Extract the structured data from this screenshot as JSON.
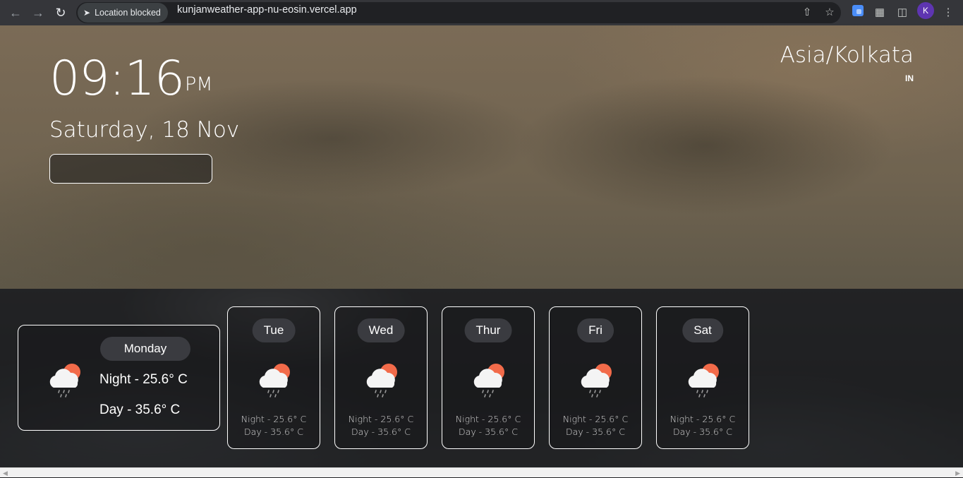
{
  "browser": {
    "location_chip": "Location blocked",
    "url": "kunjanweather-app-nu-eosin.vercel.app",
    "avatar_letter": "K"
  },
  "clock": {
    "time": "09:16",
    "ampm": "PM",
    "date": "Saturday, 18 Nov"
  },
  "location": {
    "timezone": "Asia/Kolkata",
    "country": "IN"
  },
  "today": {
    "day": "Monday",
    "night": "Night - 25.6° C",
    "day_temp": "Day - 35.6° C",
    "icon": "cloud-sun-rain-icon"
  },
  "forecast": [
    {
      "day": "Tue",
      "night": "Night - 25.6° C",
      "day_temp": "Day - 35.6° C",
      "icon": "cloud-sun-rain-icon"
    },
    {
      "day": "Wed",
      "night": "Night - 25.6° C",
      "day_temp": "Day - 35.6° C",
      "icon": "cloud-sun-rain-icon"
    },
    {
      "day": "Thur",
      "night": "Night - 25.6° C",
      "day_temp": "Day - 35.6° C",
      "icon": "cloud-sun-rain-icon"
    },
    {
      "day": "Fri",
      "night": "Night - 25.6° C",
      "day_temp": "Day - 35.6° C",
      "icon": "cloud-sun-rain-icon"
    },
    {
      "day": "Sat",
      "night": "Night - 25.6° C",
      "day_temp": "Day - 35.6° C",
      "icon": "cloud-sun-rain-icon"
    }
  ],
  "colors": {
    "sun": "#f26b4a",
    "cloud": "#f4f4f4",
    "pill": "#3a3b40"
  }
}
